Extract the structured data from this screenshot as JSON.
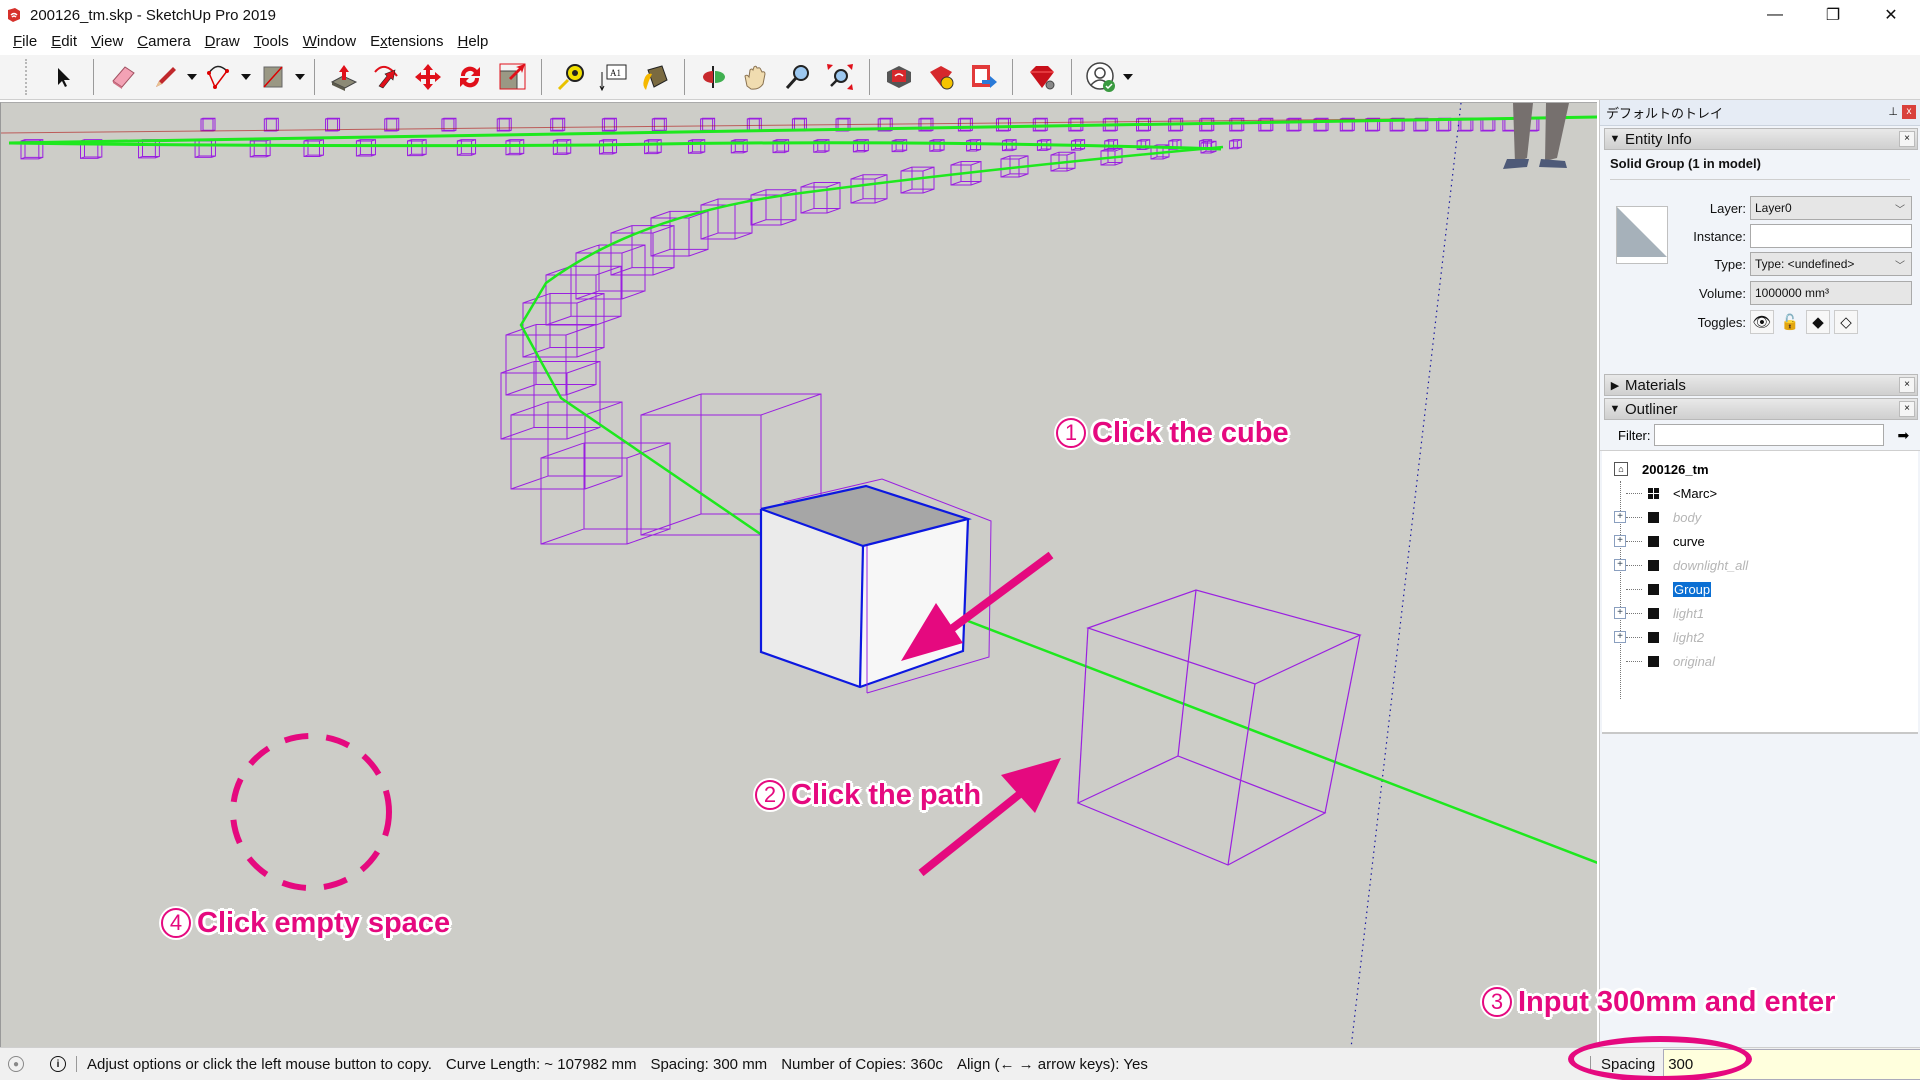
{
  "window": {
    "title": "200126_tm.skp - SketchUp Pro 2019",
    "controls": {
      "minimize": "—",
      "maximize": "❐",
      "close": "✕"
    }
  },
  "menu": [
    {
      "label": "File",
      "accel": "F",
      "rest": "ile"
    },
    {
      "label": "Edit",
      "accel": "E",
      "rest": "dit"
    },
    {
      "label": "View",
      "accel": "V",
      "rest": "iew"
    },
    {
      "label": "Camera",
      "accel": "C",
      "rest": "amera"
    },
    {
      "label": "Draw",
      "accel": "D",
      "rest": "raw"
    },
    {
      "label": "Tools",
      "accel": "T",
      "rest": "ools"
    },
    {
      "label": "Window",
      "accel": "W",
      "rest": "indow"
    },
    {
      "label": "Extensions",
      "accel": "x",
      "pre": "E",
      "rest": "tensions"
    },
    {
      "label": "Help",
      "accel": "H",
      "rest": "elp"
    }
  ],
  "toolbar": {
    "tools": [
      "select-icon",
      "eraser-icon",
      "pencil-line-icon",
      "arc-icon",
      "rectangle-icon",
      "push-pull-icon",
      "follow-me-icon",
      "move-icon",
      "rotate-icon",
      "scale-icon",
      "tape-measure-icon",
      "text-icon",
      "paint-bucket-icon",
      "orbit-icon",
      "pan-icon",
      "zoom-icon",
      "zoom-extents-icon",
      "3d-warehouse-icon",
      "extension-warehouse-icon",
      "send-to-layout-icon",
      "ruby-extension-manager-icon",
      "account-icon"
    ],
    "text_tool_glyph": "A1"
  },
  "annotations": {
    "step1": {
      "num": "1",
      "text": "Click the cube"
    },
    "step2": {
      "num": "2",
      "text": "Click the path"
    },
    "step3": {
      "num": "3",
      "text": "Input 300mm and enter"
    },
    "step4": {
      "num": "4",
      "text": "Click empty space"
    },
    "accent_color": "#e5097f"
  },
  "tray": {
    "title": "デフォルトのトレイ",
    "pin": "⊥",
    "close": "x",
    "entity_info": {
      "header": "Entity Info",
      "selection": "Solid Group (1 in model)",
      "layer_label": "Layer:",
      "layer_value": "Layer0",
      "instance_label": "Instance:",
      "instance_value": "",
      "type_label": "Type:",
      "type_value": "Type: <undefined>",
      "volume_label": "Volume:",
      "volume_value": "1000000 mm³",
      "toggles_label": "Toggles:"
    },
    "materials": {
      "header": "Materials"
    },
    "outliner": {
      "header": "Outliner",
      "filter_label": "Filter:",
      "filter_value": "",
      "root": "200126_tm",
      "items": [
        {
          "name": "<Marc>",
          "type": "component",
          "expandable": false,
          "hidden": false,
          "selected": false
        },
        {
          "name": "body",
          "type": "group",
          "expandable": true,
          "hidden": true,
          "selected": false
        },
        {
          "name": "curve",
          "type": "group",
          "expandable": true,
          "hidden": false,
          "selected": false
        },
        {
          "name": "downlight_all",
          "type": "group",
          "expandable": true,
          "hidden": true,
          "selected": false
        },
        {
          "name": "Group",
          "type": "group",
          "expandable": false,
          "hidden": false,
          "selected": true
        },
        {
          "name": "light1",
          "type": "group",
          "expandable": true,
          "hidden": true,
          "selected": false
        },
        {
          "name": "light2",
          "type": "group",
          "expandable": true,
          "hidden": true,
          "selected": false
        },
        {
          "name": "original",
          "type": "group",
          "expandable": false,
          "hidden": true,
          "selected": false
        }
      ]
    }
  },
  "statusbar": {
    "message": "Adjust options or click the left mouse button to copy.",
    "curve_length": "Curve Length: ~ 107982 mm",
    "spacing": "Spacing: 300 mm",
    "copies": "Number of Copies: 360c",
    "align": "Align (← → arrow keys): Yes",
    "vcb_label": "Spacing",
    "vcb_value": "300"
  }
}
